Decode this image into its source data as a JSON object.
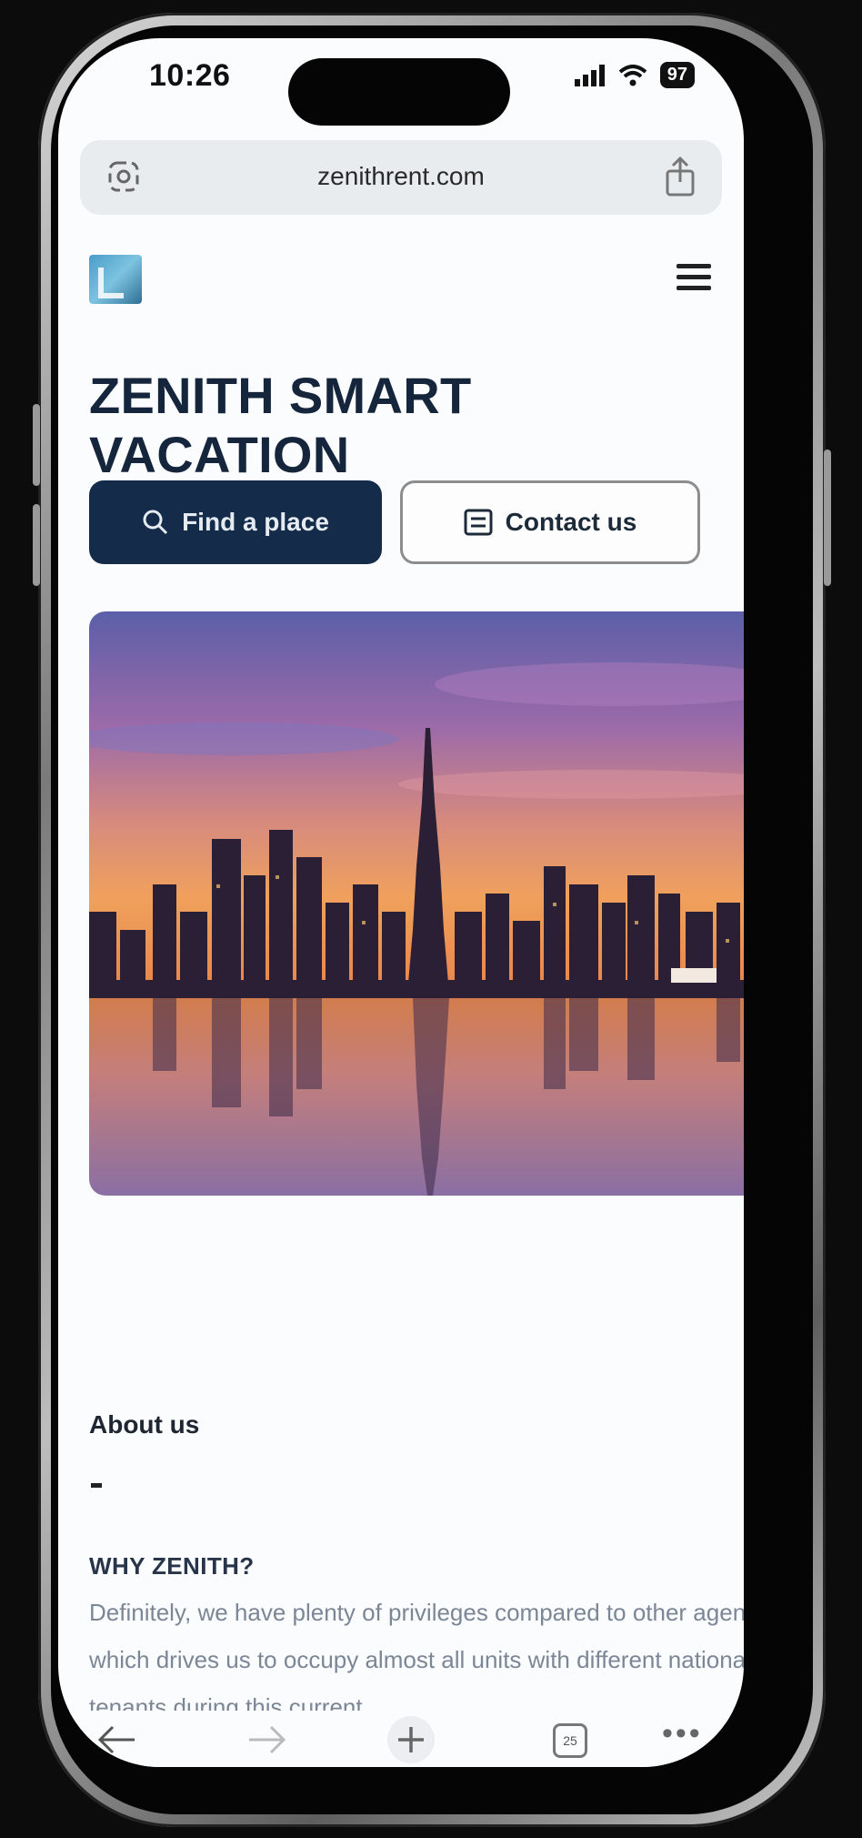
{
  "status_bar": {
    "time": "10:26",
    "battery": "97",
    "signal_icon": "signal-bars-icon",
    "wifi_icon": "wifi-icon"
  },
  "browser": {
    "url": "zenithrent.com",
    "left_icon": "page-settings-icon",
    "right_icon": "share-icon",
    "tab_count": "25"
  },
  "site": {
    "logo_icon": "zenith-logo",
    "menu_icon": "hamburger-menu-icon",
    "title": "ZENITH SMART VACATION",
    "buttons": {
      "find_label": "Find a place",
      "contact_label": "Contact us"
    },
    "hero_image": "city-skyline-at-sunset-image",
    "about": {
      "label": "About us",
      "dash": "-",
      "heading": "WHY ZENITH?",
      "paragraph": "Definitely, we have plenty of privileges compared to other agencies which drives us to occupy almost all units with different national tenants during this current"
    }
  },
  "toolbar": {
    "back_icon": "arrow-left-icon",
    "forward_icon": "arrow-right-icon",
    "new_tab_icon": "plus-icon",
    "tabs_icon": "tabs-icon",
    "more_icon": "more-dots-icon",
    "more_glyph": "•••"
  },
  "colors": {
    "primary_button": "#142c4a",
    "title_text": "#15263c",
    "body_text": "#7b8696",
    "url_bar": "#e9ecef"
  }
}
